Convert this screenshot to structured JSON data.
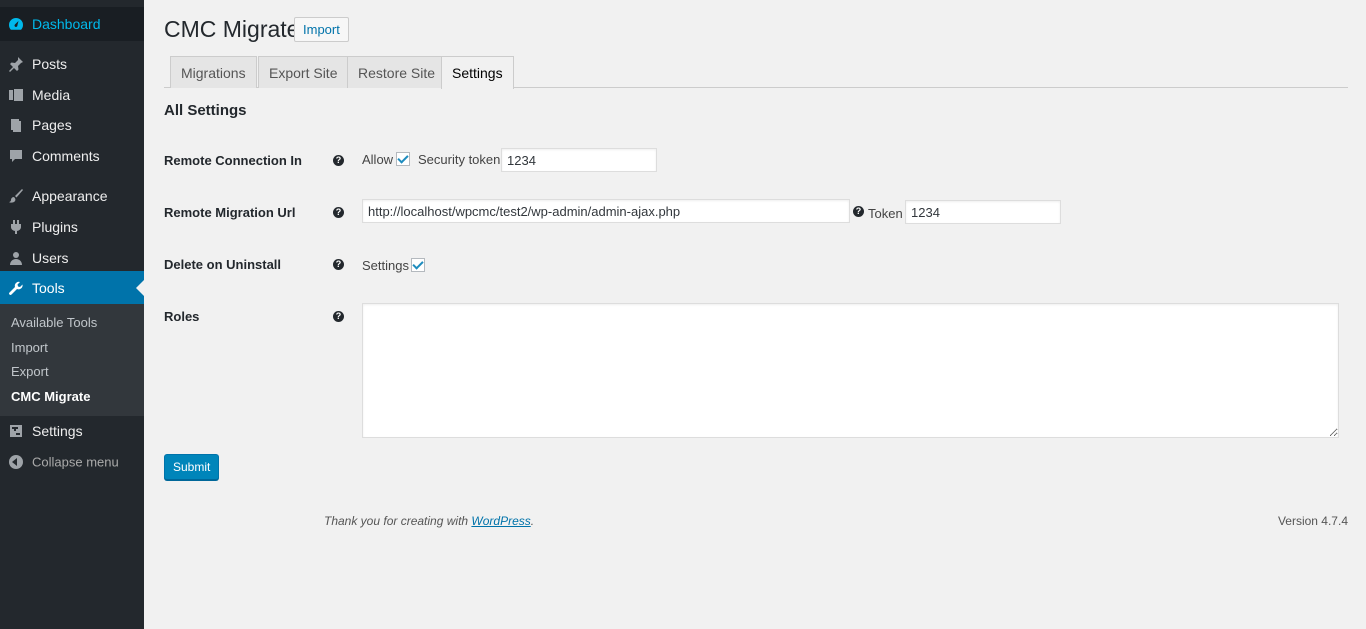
{
  "sidebar": {
    "items": [
      {
        "label": "Dashboard",
        "icon": "dashboard-icon"
      },
      {
        "label": "Posts",
        "icon": "pin-icon"
      },
      {
        "label": "Media",
        "icon": "media-icon"
      },
      {
        "label": "Pages",
        "icon": "pages-icon"
      },
      {
        "label": "Comments",
        "icon": "comment-icon"
      },
      {
        "label": "Appearance",
        "icon": "brush-icon"
      },
      {
        "label": "Plugins",
        "icon": "plugin-icon"
      },
      {
        "label": "Users",
        "icon": "user-icon"
      },
      {
        "label": "Tools",
        "icon": "wrench-icon"
      },
      {
        "label": "Settings",
        "icon": "settings-icon"
      },
      {
        "label": "Collapse menu",
        "icon": "collapse-icon"
      }
    ],
    "submenu": [
      "Available Tools",
      "Import",
      "Export",
      "CMC Migrate"
    ]
  },
  "header": {
    "title": "CMC Migrate",
    "action": "Import"
  },
  "tabs": [
    "Migrations",
    "Export Site",
    "Restore Site",
    "Settings"
  ],
  "main": {
    "section_title": "All Settings",
    "help_glyph": "?",
    "rows": {
      "remote_in": {
        "label": "Remote Connection In",
        "allow_label": "Allow",
        "token_label": "Security token",
        "token_value": "1234"
      },
      "remote_url": {
        "label": "Remote Migration Url",
        "url_value": "http://localhost/wpcmc/test2/wp-admin/admin-ajax.php",
        "token_label": "Token",
        "token_value": "1234"
      },
      "uninstall": {
        "label": "Delete on Uninstall",
        "settings_label": "Settings"
      },
      "roles": {
        "label": "Roles"
      }
    },
    "submit_label": "Submit"
  },
  "footer": {
    "thanks_prefix": "Thank you for creating with ",
    "thanks_link": "WordPress",
    "thanks_suffix": ".",
    "version": "Version 4.7.4"
  },
  "colors": {
    "sidebar_bg": "#23282d",
    "accent": "#0073aa",
    "page_bg": "#f1f1f1"
  }
}
